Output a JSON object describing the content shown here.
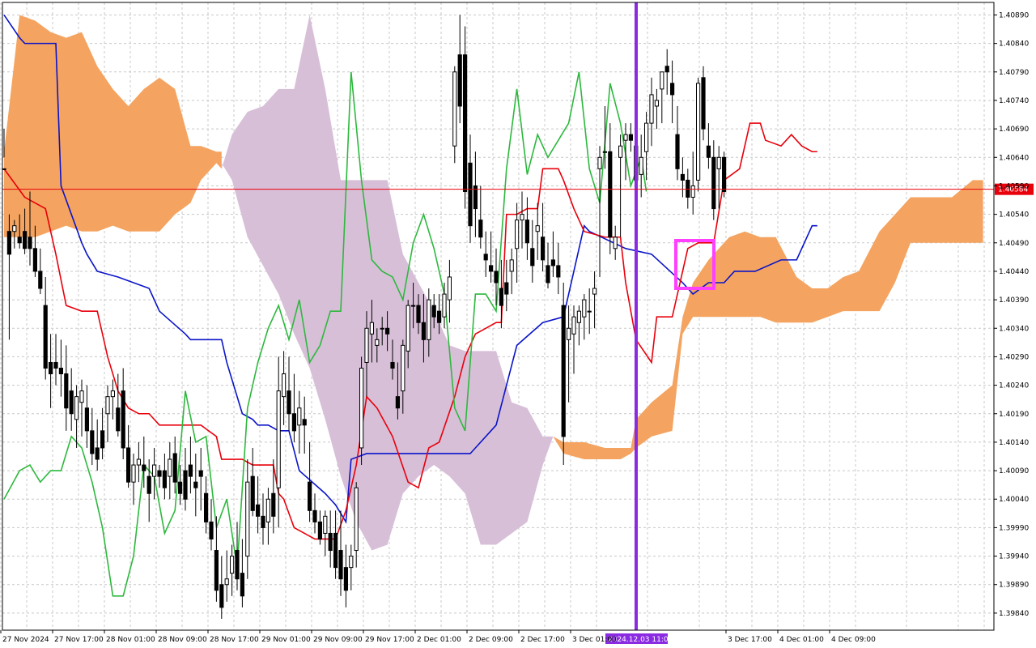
{
  "chart_data": {
    "type": "candlestick",
    "timeframe_note": "",
    "y_ticks": [
      "1.40890",
      "1.40840",
      "1.40790",
      "1.40740",
      "1.40690",
      "1.40640",
      "1.40590",
      "1.40540",
      "1.40490",
      "1.40440",
      "1.40390",
      "1.40340",
      "1.40290",
      "1.40240",
      "1.40190",
      "1.40140",
      "1.40090",
      "1.40040",
      "1.39990",
      "1.39940",
      "1.39890",
      "1.39840"
    ],
    "x_ticks": [
      "27 Nov 2024",
      "27 Nov 17:00",
      "28 Nov 01:00",
      "28 Nov 09:00",
      "28 Nov 17:00",
      "29 Nov 01:00",
      "29 Nov 09:00",
      "29 Nov 17:00",
      "2 Dec 01:00",
      "2 Dec 09:00",
      "2 Dec 17:00",
      "3 Dec 01:00",
      "3 Dec 17:00",
      "4 Dec 01:00",
      "4 Dec 09:00"
    ],
    "ylim": [
      1.3981,
      1.40912
    ],
    "current_price": "1.40584",
    "highlight_time": "2024.12.03 11:00",
    "colors": {
      "tenkan": "#e8000b",
      "kijun": "#0a14c8",
      "chikou": "#2db83d",
      "cloud_bull": "#f4a460",
      "cloud_bear": "#d8bfd8",
      "marker_line": "#8a2be2",
      "box": "#ff40ff",
      "price_line": "#e8000b"
    },
    "candles": [
      [
        1.4069,
        1.4062,
        1.4064,
        1.4062
      ],
      [
        1.4054,
        1.4051,
        1.4032,
        1.4047
      ],
      [
        1.4053,
        1.4051,
        1.4048,
        1.4052
      ],
      [
        1.4054,
        1.405,
        1.4048,
        1.4049
      ],
      [
        1.4055,
        1.4051,
        1.4047,
        1.4048
      ],
      [
        1.4058,
        1.405,
        1.4045,
        1.4048
      ],
      [
        1.4052,
        1.4048,
        1.4043,
        1.4044
      ],
      [
        1.4048,
        1.4044,
        1.404,
        1.4041
      ],
      [
        1.4043,
        1.4038,
        1.4025,
        1.4027
      ],
      [
        1.4033,
        1.4028,
        1.402,
        1.4026
      ],
      [
        1.4033,
        1.4028,
        1.4024,
        1.4027
      ],
      [
        1.4032,
        1.4027,
        1.4022,
        1.4026
      ],
      [
        1.4031,
        1.4026,
        1.4016,
        1.402
      ],
      [
        1.4027,
        1.4023,
        1.4016,
        1.4019
      ],
      [
        1.4024,
        1.4018,
        1.4013,
        1.4022
      ],
      [
        1.4025,
        1.4021,
        1.4015,
        1.4023
      ],
      [
        1.4024,
        1.402,
        1.4013,
        1.4016
      ],
      [
        1.402,
        1.4016,
        1.401,
        1.4012
      ],
      [
        1.4018,
        1.4013,
        1.4009,
        1.4011
      ],
      [
        1.402,
        1.4016,
        1.4011,
        1.4013
      ],
      [
        1.4024,
        1.4019,
        1.4014,
        1.4022
      ],
      [
        1.4025,
        1.4022,
        1.4018,
        1.4023
      ],
      [
        1.4026,
        1.402,
        1.4015,
        1.4016
      ],
      [
        1.4027,
        1.4023,
        1.4011,
        1.4013
      ],
      [
        1.4017,
        1.4013,
        1.4006,
        1.4007
      ],
      [
        1.4012,
        1.4007,
        1.4003,
        1.401
      ],
      [
        1.4014,
        1.401,
        1.4007,
        1.4011
      ],
      [
        1.4015,
        1.401,
        1.4006,
        1.4009
      ],
      [
        1.4011,
        1.4008,
        1.4,
        1.4005
      ],
      [
        1.4013,
        1.4008,
        1.4004,
        1.401
      ],
      [
        1.401,
        1.4009,
        1.4006,
        1.4008
      ],
      [
        1.4012,
        1.4009,
        1.4004,
        1.4006
      ],
      [
        1.4014,
        1.4008,
        1.4004,
        1.4011
      ],
      [
        1.4015,
        1.4012,
        1.4005,
        1.4007
      ],
      [
        1.401,
        1.4007,
        1.4003,
        1.4005
      ],
      [
        1.4013,
        1.4009,
        1.4002,
        1.4004
      ],
      [
        1.4015,
        1.401,
        1.4005,
        1.4008
      ],
      [
        1.4012,
        1.4007,
        1.4001,
        1.4006
      ],
      [
        1.4013,
        1.4009,
        1.4002,
        1.4008
      ],
      [
        1.4008,
        1.4005,
        1.3998,
        1.4
      ],
      [
        1.4004,
        1.4,
        1.3995,
        1.3997
      ],
      [
        1.4001,
        1.3995,
        1.3986,
        1.3988
      ],
      [
        1.3994,
        1.3989,
        1.3983,
        1.3985
      ],
      [
        1.3995,
        1.3989,
        1.3986,
        1.399
      ],
      [
        1.3996,
        1.3991,
        1.3987,
        1.3994
      ],
      [
        1.4,
        1.3995,
        1.3988,
        1.399
      ],
      [
        1.3997,
        1.3991,
        1.3985,
        1.3987
      ],
      [
        1.4011,
        1.3994,
        1.399,
        1.4007
      ],
      [
        1.4013,
        1.4008,
        1.4001,
        1.4002
      ],
      [
        1.4008,
        1.4003,
        1.3998,
        1.4001
      ],
      [
        1.4005,
        1.4001,
        1.3996,
        1.3999
      ],
      [
        1.4006,
        1.4,
        1.3996,
        1.4004
      ],
      [
        1.4011,
        1.4005,
        1.3998,
        1.4001
      ],
      [
        1.4029,
        1.4006,
        1.3999,
        1.4023
      ],
      [
        1.403,
        1.4022,
        1.4017,
        1.4026
      ],
      [
        1.4029,
        1.4023,
        1.4016,
        1.4019
      ],
      [
        1.4026,
        1.4019,
        1.4014,
        1.4016
      ],
      [
        1.4023,
        1.4017,
        1.4012,
        1.402
      ],
      [
        1.4022,
        1.4018,
        1.4012,
        1.4017
      ],
      [
        1.4014,
        1.4007,
        1.4,
        1.4002
      ],
      [
        1.4005,
        1.4002,
        1.3998,
        1.4
      ],
      [
        1.4002,
        1.4,
        1.3996,
        1.3997
      ],
      [
        1.4002,
        1.3998,
        1.3994,
        1.4001
      ],
      [
        1.4002,
        1.3998,
        1.3992,
        1.3995
      ],
      [
        1.4002,
        1.3998,
        1.399,
        1.3992
      ],
      [
        1.4002,
        1.3995,
        1.3987,
        1.399
      ],
      [
        1.3996,
        1.3992,
        1.3985,
        1.3988
      ],
      [
        1.3996,
        1.3992,
        1.3988,
        1.3994
      ],
      [
        1.4007,
        1.3995,
        1.3992,
        1.4006
      ],
      [
        1.4029,
        1.4013,
        1.401,
        1.4027
      ],
      [
        1.4037,
        1.4028,
        1.4022,
        1.4034
      ],
      [
        1.4039,
        1.4033,
        1.4028,
        1.4035
      ],
      [
        1.4034,
        1.4031,
        1.4028,
        1.4032
      ],
      [
        1.4036,
        1.4034,
        1.4031,
        1.4034
      ],
      [
        1.4037,
        1.4034,
        1.403,
        1.4033
      ],
      [
        1.4032,
        1.4028,
        1.4025,
        1.4027
      ],
      [
        1.4028,
        1.4022,
        1.4018,
        1.402
      ],
      [
        1.4032,
        1.4023,
        1.4019,
        1.4031
      ],
      [
        1.4039,
        1.403,
        1.4027,
        1.4038
      ],
      [
        1.4042,
        1.4038,
        1.4034,
        1.4038
      ],
      [
        1.404,
        1.4038,
        1.4033,
        1.4035
      ],
      [
        1.404,
        1.4035,
        1.4028,
        1.4032
      ],
      [
        1.4041,
        1.4032,
        1.4029,
        1.4039
      ],
      [
        1.404,
        1.4038,
        1.4034,
        1.4036
      ],
      [
        1.404,
        1.4037,
        1.4033,
        1.4035
      ],
      [
        1.4042,
        1.4036,
        1.4034,
        1.404
      ],
      [
        1.4046,
        1.4039,
        1.4035,
        1.4043
      ],
      [
        1.408,
        1.4066,
        1.4063,
        1.4079
      ],
      [
        1.4089,
        1.4082,
        1.407,
        1.4073
      ],
      [
        1.4087,
        1.4082,
        1.4055,
        1.4058
      ],
      [
        1.4068,
        1.4063,
        1.4049,
        1.4052
      ],
      [
        1.4065,
        1.4059,
        1.405,
        1.4055
      ],
      [
        1.4059,
        1.4053,
        1.4048,
        1.405
      ],
      [
        1.4051,
        1.4047,
        1.4043,
        1.4046
      ],
      [
        1.4051,
        1.4045,
        1.4042,
        1.4044
      ],
      [
        1.4048,
        1.4044,
        1.4038,
        1.4042
      ],
      [
        1.4046,
        1.4041,
        1.4034,
        1.4038
      ],
      [
        1.4046,
        1.4042,
        1.4037,
        1.404
      ],
      [
        1.4048,
        1.4044,
        1.404,
        1.4046
      ],
      [
        1.4056,
        1.4048,
        1.4042,
        1.4053
      ],
      [
        1.4058,
        1.4053,
        1.4048,
        1.4054
      ],
      [
        1.4057,
        1.4053,
        1.4046,
        1.4049
      ],
      [
        1.4053,
        1.4048,
        1.4042,
        1.4045
      ],
      [
        1.4056,
        1.4051,
        1.4046,
        1.4052
      ],
      [
        1.4056,
        1.405,
        1.4044,
        1.4046
      ],
      [
        1.4049,
        1.4045,
        1.4041,
        1.4042
      ],
      [
        1.4051,
        1.4046,
        1.4043,
        1.4045
      ],
      [
        1.4049,
        1.4045,
        1.404,
        1.4043
      ],
      [
        1.4042,
        1.4038,
        1.401,
        1.4015
      ],
      [
        1.4038,
        1.4032,
        1.4021,
        1.4034
      ],
      [
        1.4038,
        1.4033,
        1.4026,
        1.4036
      ],
      [
        1.4038,
        1.4035,
        1.4031,
        1.4037
      ],
      [
        1.404,
        1.4036,
        1.4032,
        1.4039
      ],
      [
        1.4041,
        1.4037,
        1.4033,
        1.4037
      ],
      [
        1.4044,
        1.404,
        1.4034,
        1.4041
      ],
      [
        1.4066,
        1.4062,
        1.4043,
        1.4064
      ],
      [
        1.4073,
        1.4065,
        1.4062,
        1.4065
      ],
      [
        1.407,
        1.4065,
        1.4047,
        1.405
      ],
      [
        1.4052,
        1.4048,
        1.4046,
        1.405
      ],
      [
        1.4068,
        1.4064,
        1.405,
        1.4066
      ],
      [
        1.407,
        1.4067,
        1.406,
        1.4068
      ],
      [
        1.407,
        1.4068,
        1.4065,
        1.4067
      ],
      [
        1.407,
        1.4066,
        1.4059,
        1.406
      ],
      [
        1.4068,
        1.4061,
        1.4057,
        1.4064
      ],
      [
        1.4072,
        1.4065,
        1.406,
        1.407
      ],
      [
        1.4078,
        1.407,
        1.4066,
        1.4075
      ],
      [
        1.4076,
        1.4073,
        1.4069,
        1.4074
      ],
      [
        1.4079,
        1.4076,
        1.407,
        1.4079
      ],
      [
        1.4083,
        1.408,
        1.4075,
        1.4079
      ],
      [
        1.4081,
        1.4077,
        1.407,
        1.4075
      ],
      [
        1.4073,
        1.4068,
        1.406,
        1.4062
      ],
      [
        1.4064,
        1.4061,
        1.4057,
        1.406
      ],
      [
        1.4062,
        1.406,
        1.4055,
        1.4057
      ],
      [
        1.4065,
        1.4057,
        1.4054,
        1.4059
      ],
      [
        1.4078,
        1.406,
        1.4058,
        1.4077
      ],
      [
        1.408,
        1.4078,
        1.4067,
        1.4069
      ],
      [
        1.407,
        1.4066,
        1.4062,
        1.4064
      ],
      [
        1.4067,
        1.4064,
        1.4053,
        1.4055
      ],
      [
        1.4066,
        1.4062,
        1.4055,
        1.4064
      ],
      [
        1.4065,
        1.4064,
        1.4057,
        1.4058
      ]
    ]
  }
}
